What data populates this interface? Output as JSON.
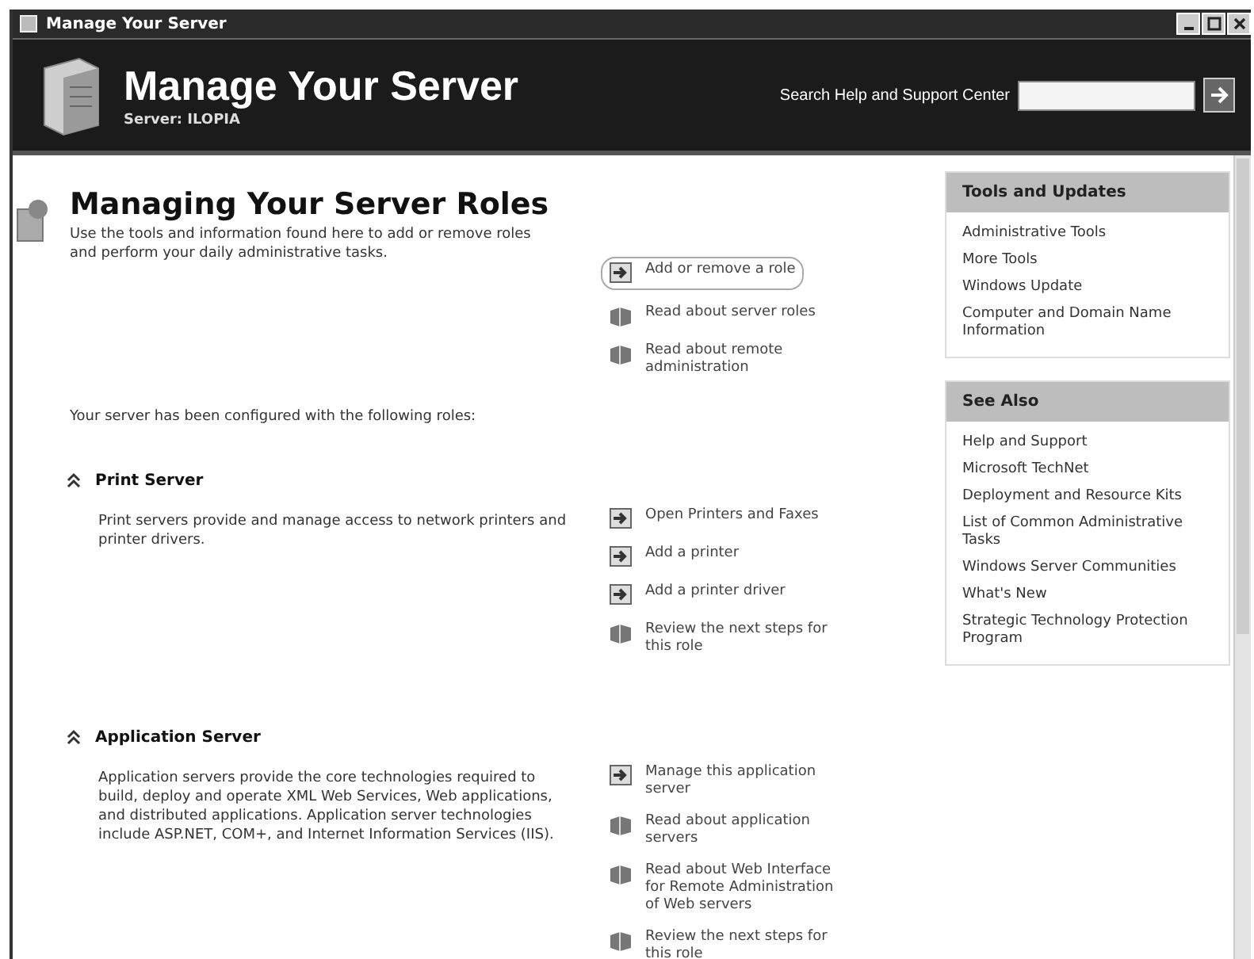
{
  "window": {
    "title": "Manage Your Server"
  },
  "header": {
    "title": "Manage Your Server",
    "server": "Server: ILOPIA",
    "search_label": "Search Help and Support Center"
  },
  "intro": {
    "title": "Managing Your Server Roles",
    "description": "Use the tools and information found here to add or remove roles and perform your daily administrative tasks.",
    "actions": [
      {
        "kind": "task",
        "label": "Add or remove a role",
        "selected": true
      },
      {
        "kind": "info",
        "label": "Read about server roles",
        "selected": false
      },
      {
        "kind": "info",
        "label": "Read about remote administration",
        "selected": false
      }
    ]
  },
  "configured_text": "Your server has been configured with the following roles:",
  "roles": [
    {
      "name": "Print Server",
      "description": "Print servers provide and manage access to network printers and printer drivers.",
      "actions": [
        {
          "kind": "task",
          "label": "Open Printers and Faxes"
        },
        {
          "kind": "task",
          "label": "Add a printer"
        },
        {
          "kind": "task",
          "label": "Add a printer driver"
        },
        {
          "kind": "info",
          "label": "Review the next steps for this role"
        }
      ]
    },
    {
      "name": "Application Server",
      "description": "Application servers provide the core technologies required to build, deploy and operate XML Web Services, Web applications, and distributed applications. Application server technologies include ASP.NET, COM+, and Internet Information Services (IIS).",
      "actions": [
        {
          "kind": "task",
          "label": "Manage this application server"
        },
        {
          "kind": "info",
          "label": "Read about application servers"
        },
        {
          "kind": "info",
          "label": "Read about Web Interface for Remote Administration of Web servers"
        },
        {
          "kind": "info",
          "label": "Review the next steps for this role"
        }
      ]
    }
  ],
  "sidebar": [
    {
      "title": "Tools and Updates",
      "links": [
        "Administrative Tools",
        "More Tools",
        "Windows Update",
        "Computer and Domain Name Information"
      ]
    },
    {
      "title": "See Also",
      "links": [
        "Help and Support",
        "Microsoft TechNet",
        "Deployment and Resource Kits",
        "List of Common Administrative Tasks",
        "Windows Server Communities",
        "What's New",
        "Strategic Technology Protection Program"
      ]
    }
  ]
}
